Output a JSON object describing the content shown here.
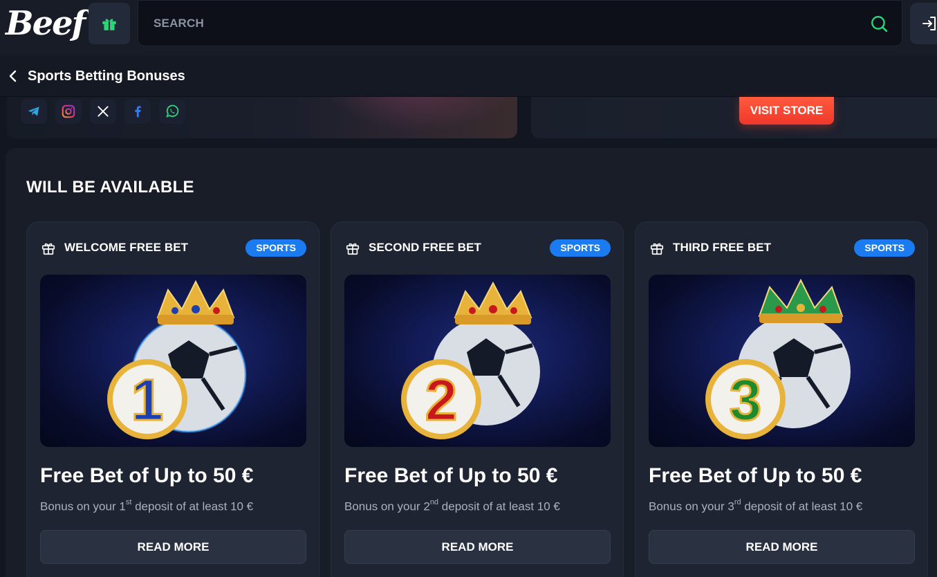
{
  "header": {
    "logo_text": "Beef",
    "search_placeholder": "SEARCH",
    "accent_color": "#2bd67b"
  },
  "breadcrumb": {
    "title": "Sports Betting Bonuses"
  },
  "banner": {
    "visit_store_label": "VISIT STORE",
    "socials": [
      "telegram-icon",
      "instagram-icon",
      "x-icon",
      "facebook-icon",
      "whatsapp-icon"
    ]
  },
  "section": {
    "title": "WILL BE AVAILABLE"
  },
  "cards": [
    {
      "title": "WELCOME FREE BET",
      "badge": "SPORTS",
      "number": "1",
      "number_color": "#1d3fb0",
      "amount": "Free Bet of Up to 50 €",
      "desc_prefix": "Bonus on your 1",
      "desc_sup": "st",
      "desc_suffix": " deposit of at least 10 €",
      "button": "READ MORE"
    },
    {
      "title": "SECOND FREE BET",
      "badge": "SPORTS",
      "number": "2",
      "number_color": "#c8181c",
      "amount": "Free Bet of Up to 50 €",
      "desc_prefix": "Bonus on your 2",
      "desc_sup": "nd",
      "desc_suffix": " deposit of at least 10 €",
      "button": "READ MORE"
    },
    {
      "title": "THIRD FREE BET",
      "badge": "SPORTS",
      "number": "3",
      "number_color": "#1e8a2c",
      "amount": "Free Bet of Up to 50 €",
      "desc_prefix": "Bonus on your 3",
      "desc_sup": "rd",
      "desc_suffix": " deposit of at least 10 €",
      "button": "READ MORE"
    }
  ]
}
